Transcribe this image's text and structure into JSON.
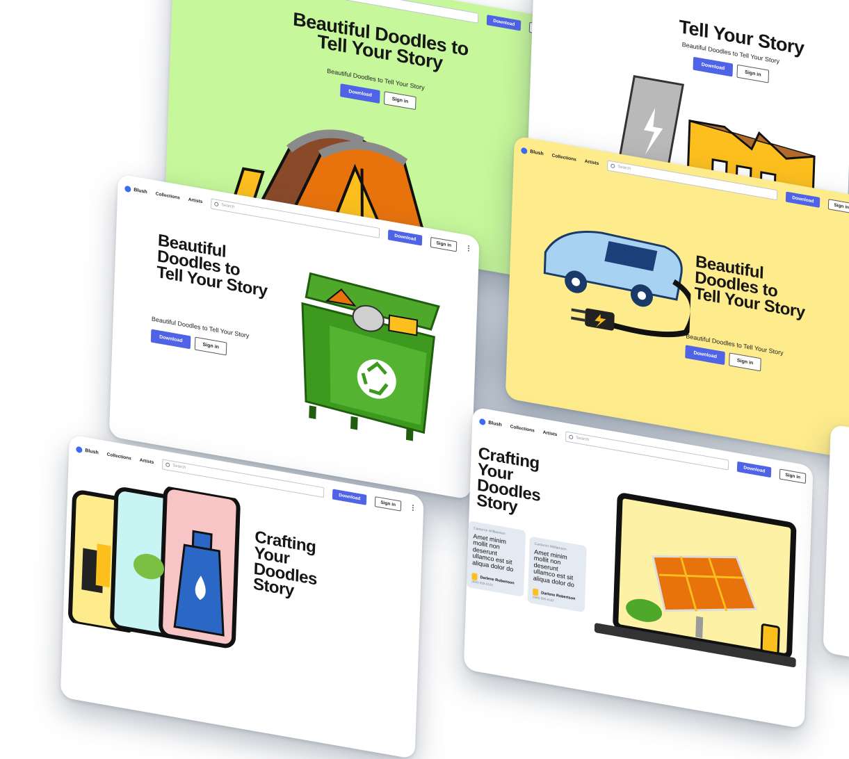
{
  "nav": {
    "brand": "Blush",
    "links": [
      "Collections",
      "Artists"
    ],
    "search_placeholder": "Search",
    "download": "Download",
    "signin": "Sign in"
  },
  "cards": {
    "tent": {
      "title": "Beautiful Doodles to Tell Your Story",
      "subtitle": "Beautiful Doodles to Tell Your Story",
      "download": "Download",
      "signin": "Sign in"
    },
    "factory": {
      "title": "Tell Your Story",
      "subtitle": "Beautiful Doodles to Tell Your Story",
      "download": "Download",
      "signin": "Sign in"
    },
    "dumpster": {
      "title": "Beautiful Doodles to Tell Your Story",
      "subtitle": "Beautiful Doodles to Tell Your Story",
      "download": "Download",
      "signin": "Sign in"
    },
    "car": {
      "title": "Beautiful Doodles to Tell Your Story",
      "subtitle": "Beautiful Doodles to Tell Your Story",
      "download": "Download",
      "signin": "Sign in"
    },
    "phones": {
      "title": "Crafting Your Doodles Story"
    },
    "laptop": {
      "title": "Crafting Your Doodles Story",
      "quotes": [
        {
          "name": "Cameron Williamson",
          "text": "Amet minim mollit non deserunt ullamco est sit aliqua dolor do",
          "author": "Darlene Robertson",
          "phone": "(684) 555-0102"
        },
        {
          "name": "Cameron Williamson",
          "text": "Amet minim mollit non deserunt ullamco est sit aliqua dolor do",
          "author": "Darlene Robertson",
          "phone": "(684) 555-0102"
        }
      ]
    }
  },
  "colors": {
    "accent": "#4f63e6",
    "green_bg": "#c6f79a",
    "yellow_bg": "#fdeb8c",
    "orange": "#e8730c",
    "dumpster_green": "#3d9a1e"
  }
}
